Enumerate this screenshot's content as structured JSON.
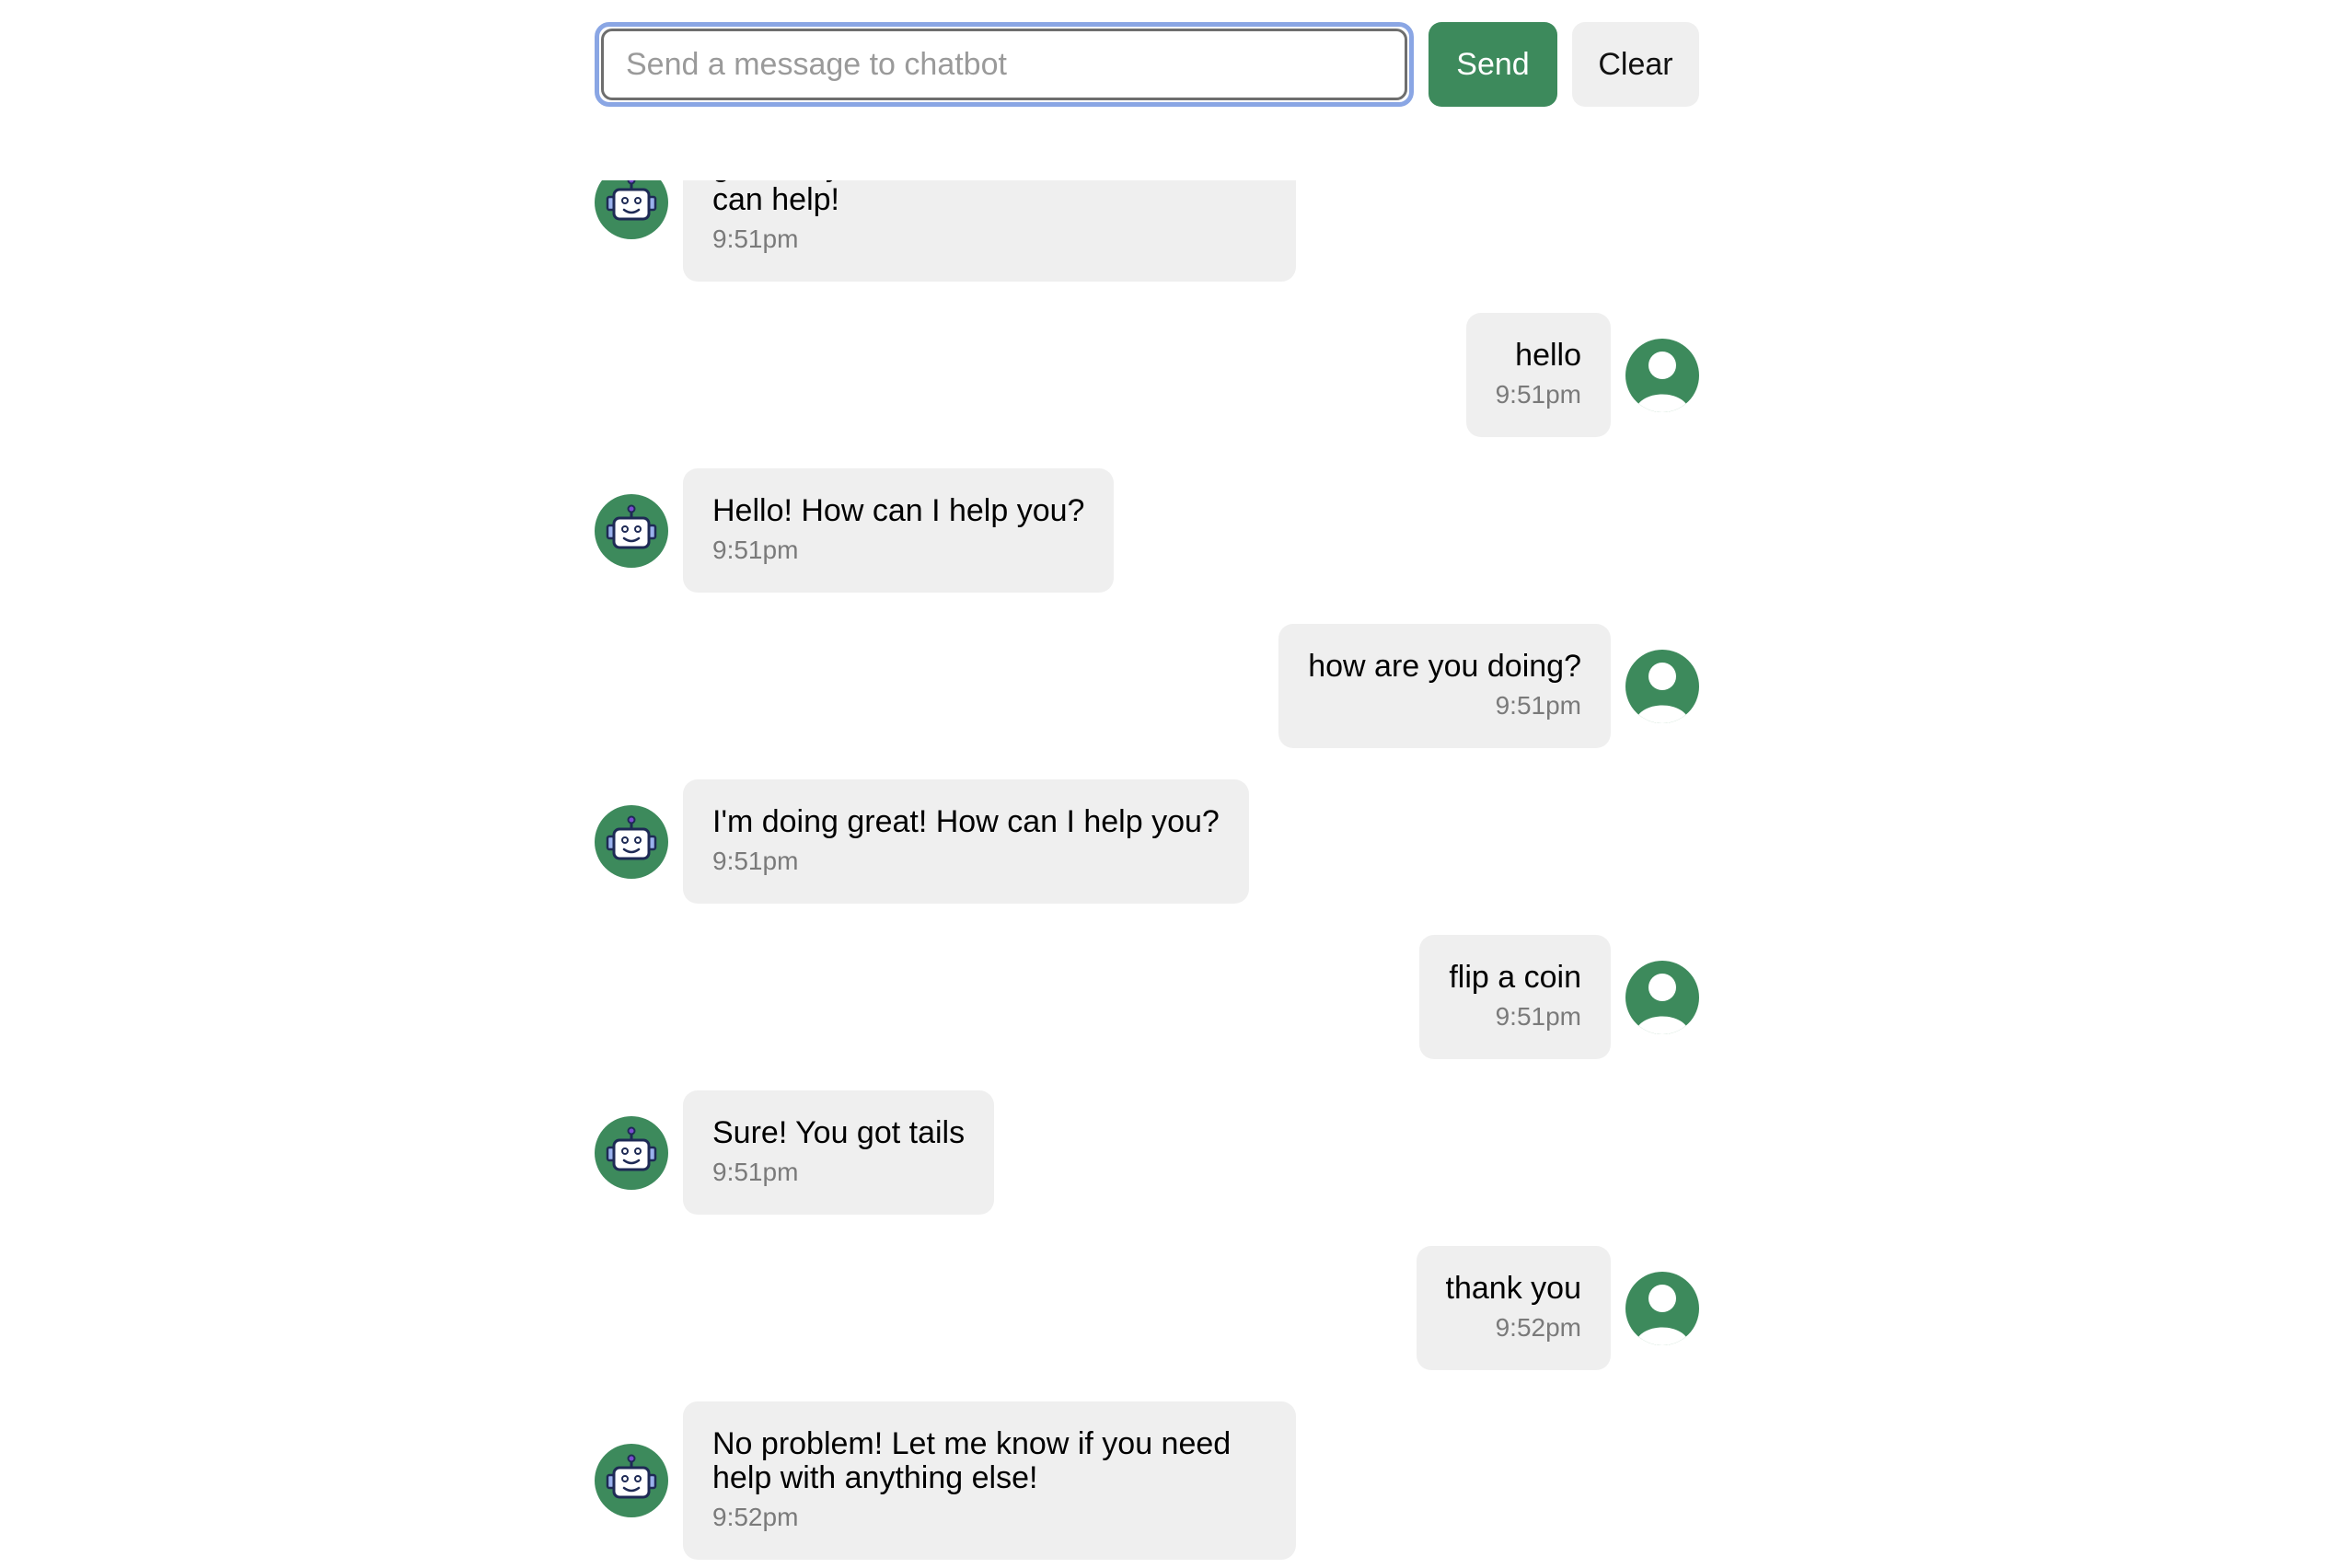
{
  "composer": {
    "placeholder": "Send a message to chatbot",
    "send_label": "Send",
    "clear_label": "Clear"
  },
  "colors": {
    "accent": "#3d8a5c",
    "bubble": "#efefef",
    "focus_ring": "#8aa6e4"
  },
  "messages": [
    {
      "sender": "bot",
      "icon": "robot-icon",
      "text": "get today's date. Let me know how I can help!",
      "time": "9:51pm"
    },
    {
      "sender": "user",
      "icon": "user-icon",
      "text": "hello",
      "time": "9:51pm"
    },
    {
      "sender": "bot",
      "icon": "robot-icon",
      "text": "Hello! How can I help you?",
      "time": "9:51pm"
    },
    {
      "sender": "user",
      "icon": "user-icon",
      "text": "how are you doing?",
      "time": "9:51pm"
    },
    {
      "sender": "bot",
      "icon": "robot-icon",
      "text": "I'm doing great! How can I help you?",
      "time": "9:51pm"
    },
    {
      "sender": "user",
      "icon": "user-icon",
      "text": "flip a coin",
      "time": "9:51pm"
    },
    {
      "sender": "bot",
      "icon": "robot-icon",
      "text": "Sure! You got tails",
      "time": "9:51pm"
    },
    {
      "sender": "user",
      "icon": "user-icon",
      "text": "thank you",
      "time": "9:52pm"
    },
    {
      "sender": "bot",
      "icon": "robot-icon",
      "text": "No problem! Let me know if you need help with anything else!",
      "time": "9:52pm"
    }
  ]
}
